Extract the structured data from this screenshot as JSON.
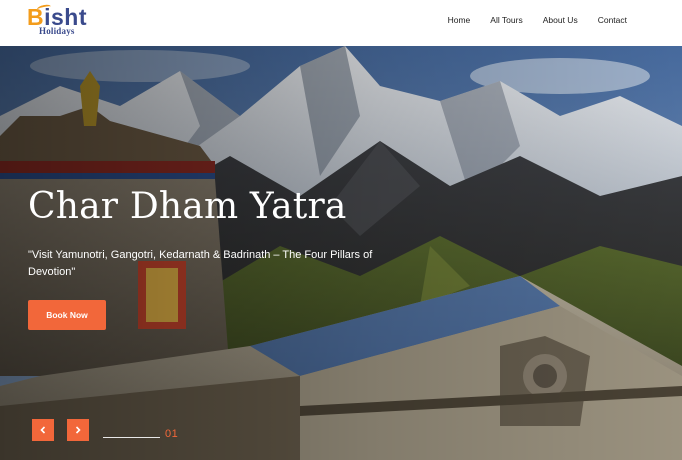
{
  "logo": {
    "brand_first": "B",
    "brand_rest": "isht",
    "sub": "Holidays",
    "colors": {
      "orange": "#f39c1b",
      "navy": "#3a4a8c"
    }
  },
  "nav": {
    "items": [
      {
        "label": "Home"
      },
      {
        "label": "All Tours"
      },
      {
        "label": "About Us"
      },
      {
        "label": "Contact"
      }
    ]
  },
  "hero": {
    "title": "Char Dham Yatra",
    "tagline": "\"Visit Yamunotri, Gangotri, Kedarnath & Badrinath – The Four Pillars of Devotion\"",
    "button_label": "Book Now",
    "slide_number": "01",
    "accent_color": "#f2673a"
  },
  "icons": {
    "prev": "chevron-left-icon",
    "next": "chevron-right-icon"
  }
}
